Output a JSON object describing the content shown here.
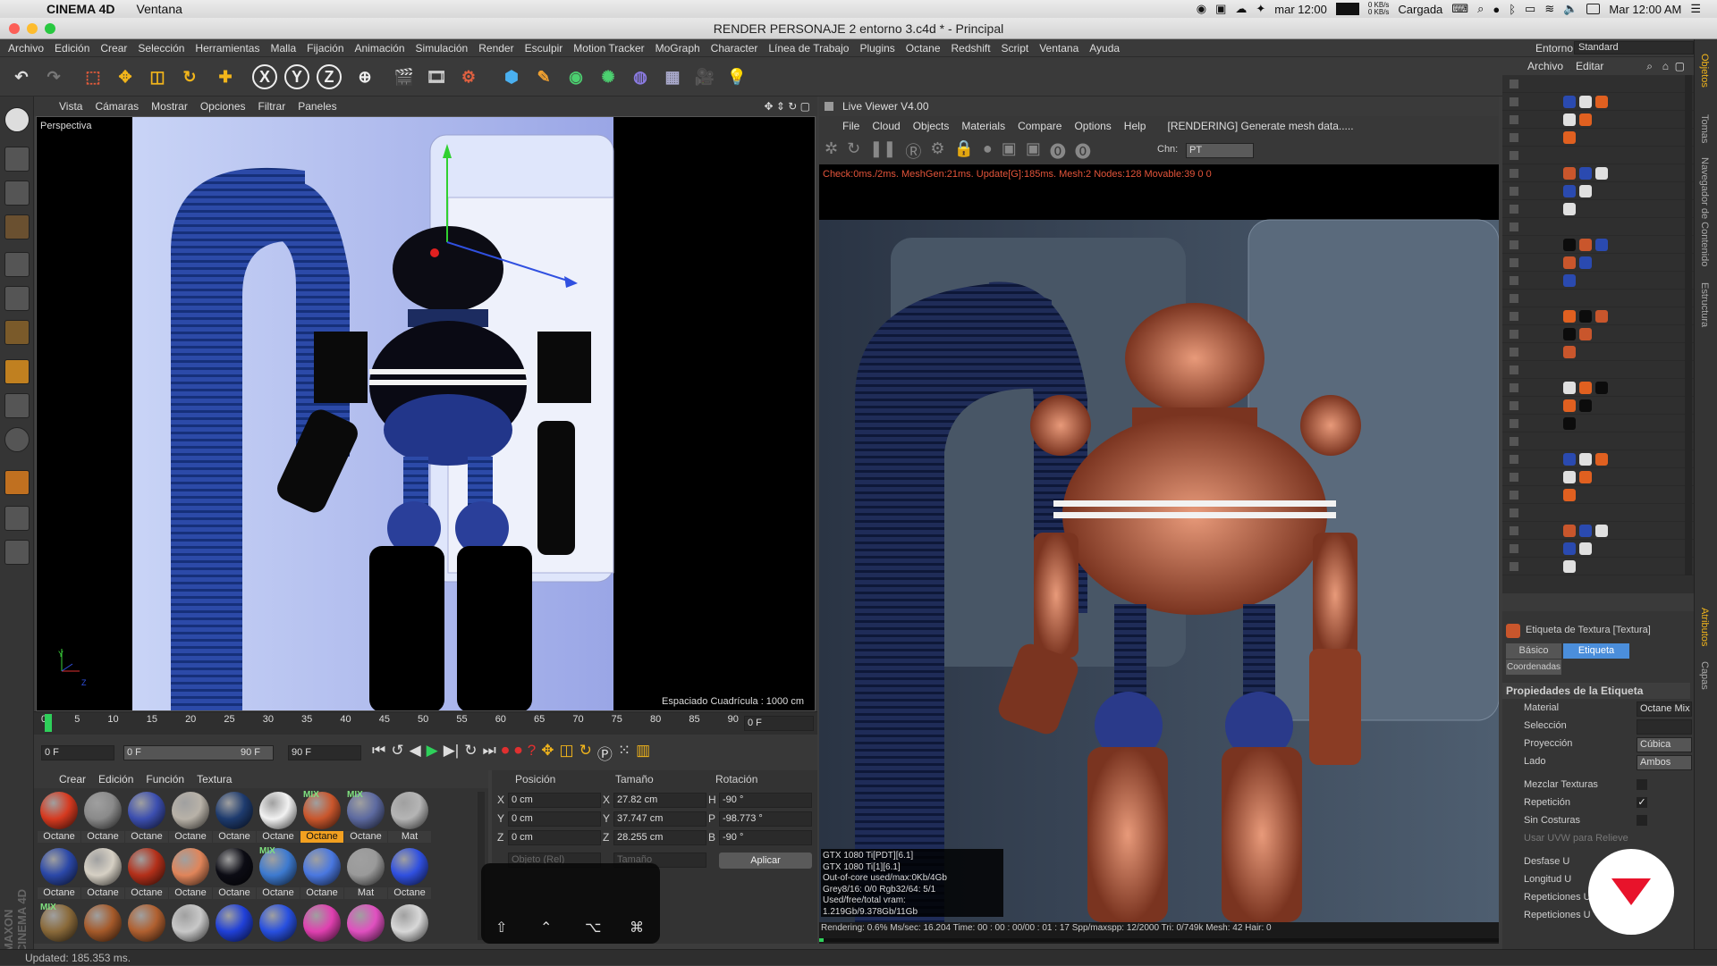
{
  "mac": {
    "app": "CINEMA 4D",
    "menu": "Ventana",
    "time_short": "mar 12:00",
    "net_up": "0 KB/s",
    "net_down": "0 KB/s",
    "battery": "Cargada",
    "datetime": "Mar 12:00 AM"
  },
  "window": {
    "title": "RENDER PERSONAJE 2 entorno 3.c4d * - Principal"
  },
  "menubar": {
    "items": [
      "Archivo",
      "Edición",
      "Crear",
      "Selección",
      "Herramientas",
      "Malla",
      "Fijación",
      "Animación",
      "Simulación",
      "Render",
      "Esculpir",
      "Motion Tracker",
      "MoGraph",
      "Character",
      "Línea de Trabajo",
      "Plugins",
      "Octane",
      "Redshift",
      "Script",
      "Ventana",
      "Ayuda"
    ],
    "entorno_label": "Entorno:",
    "entorno_value": "Standard"
  },
  "viewport": {
    "menu": [
      "Vista",
      "Cámaras",
      "Mostrar",
      "Opciones",
      "Filtrar",
      "Paneles"
    ],
    "name": "Perspectiva",
    "grid": "Espaciado Cuadrícula : 1000 cm",
    "axis_y": "Y",
    "axis_z": "Z"
  },
  "timeline": {
    "ticks": [
      "0",
      "5",
      "10",
      "15",
      "20",
      "25",
      "30",
      "35",
      "40",
      "45",
      "50",
      "55",
      "60",
      "65",
      "70",
      "75",
      "80",
      "85",
      "90"
    ],
    "frame": "0 F"
  },
  "transport": {
    "start": "0 F",
    "range_start": "0 F",
    "range_end": "90 F",
    "end": "90 F"
  },
  "materials": {
    "menu": [
      "Crear",
      "Edición",
      "Función",
      "Textura"
    ],
    "items": [
      {
        "label": "Octane",
        "color": "#d63a20",
        "mix": ""
      },
      {
        "label": "Octane",
        "color": "#8a8a8a",
        "mix": ""
      },
      {
        "label": "Octane",
        "color": "#3c4fb0",
        "mix": ""
      },
      {
        "label": "Octane",
        "color": "#b8b2a8",
        "mix": ""
      },
      {
        "label": "Octane",
        "color": "#1e3b6e",
        "mix": ""
      },
      {
        "label": "Octane",
        "color": "#f2f2f2",
        "mix": ""
      },
      {
        "label": "Octane",
        "color": "#c9562c",
        "mix": "MIX",
        "selected": true
      },
      {
        "label": "Octane",
        "color": "#5d6aa0",
        "mix": "MIX"
      },
      {
        "label": "Mat",
        "color": "#b5b5b5",
        "mix": ""
      },
      {
        "label": "Octane",
        "color": "#2b48a8",
        "mix": ""
      },
      {
        "label": "Octane",
        "color": "#d6d0c4",
        "mix": ""
      },
      {
        "label": "Octane",
        "color": "#b3301a",
        "mix": ""
      },
      {
        "label": "Octane",
        "color": "#e0855a",
        "mix": ""
      },
      {
        "label": "Octane",
        "color": "#0c0c14",
        "mix": ""
      },
      {
        "label": "Octane",
        "color": "#3d7ad0",
        "mix": "MIX"
      },
      {
        "label": "Octane",
        "color": "#4a78e0",
        "mix": ""
      },
      {
        "label": "Mat",
        "color": "#9a9a9a",
        "mix": ""
      },
      {
        "label": "Octane",
        "color": "#3050e0",
        "mix": ""
      },
      {
        "label": "",
        "color": "#8a6a3a",
        "mix": "MIX"
      },
      {
        "label": "",
        "color": "#a55a2a",
        "mix": ""
      },
      {
        "label": "",
        "color": "#b06030",
        "mix": ""
      },
      {
        "label": "",
        "color": "#c8c8c8",
        "mix": ""
      },
      {
        "label": "",
        "color": "#2040d8",
        "mix": ""
      },
      {
        "label": "",
        "color": "#2850e0",
        "mix": ""
      },
      {
        "label": "",
        "color": "#e040b0",
        "mix": ""
      },
      {
        "label": "",
        "color": "#e050c0",
        "mix": ""
      },
      {
        "label": "",
        "color": "#d8d8d8",
        "mix": ""
      }
    ]
  },
  "coords": {
    "headers": [
      "Posición",
      "Tamaño",
      "Rotación"
    ],
    "rows": [
      {
        "a": "X",
        "pos": "0 cm",
        "b": "X",
        "size": "27.82 cm",
        "c": "H",
        "rot": "-90 °"
      },
      {
        "a": "Y",
        "pos": "0 cm",
        "b": "Y",
        "size": "37.747 cm",
        "c": "P",
        "rot": "-98.773 °"
      },
      {
        "a": "Z",
        "pos": "0 cm",
        "b": "Z",
        "size": "28.255 cm",
        "c": "B",
        "rot": "-90 °"
      }
    ],
    "mode": "Objeto (Rel)",
    "size_mode": "Tamaño",
    "apply": "Aplicar"
  },
  "live_viewer": {
    "title": "Live Viewer V4.00",
    "menu": [
      "File",
      "Cloud",
      "Objects",
      "Materials",
      "Compare",
      "Options",
      "Help"
    ],
    "status_msg": "[RENDERING] Generate mesh data.....",
    "chn_label": "Chn:",
    "chn_value": "PT",
    "info": "Check:0ms./2ms. MeshGen:21ms. Update[G]:185ms. Mesh:2 Nodes:128 Movable:39  0 0",
    "stats": [
      "GTX 1080 Ti[PDT][6.1]",
      "GTX 1080 Ti[1][6.1]",
      "Out-of-core used/max:0Kb/4Gb",
      "Grey8/16: 0/0        Rgb32/64: 5/1",
      "Used/free/total vram: 1.219Gb/9.378Gb/11Gb"
    ],
    "render_bar": "Rendering: 0.6%  Ms/sec: 16.204  Time: 00 : 00 : 00/00 : 01 : 17  Spp/maxspp: 12/2000  Tri: 0/749k  Mesh: 42  Hair: 0",
    "progress": 0.006
  },
  "right": {
    "top_menu": [
      "Archivo",
      "Editar"
    ],
    "attr_title": "Etiqueta de Textura [Textura]",
    "tabs": [
      "Básico",
      "Etiqueta",
      "Coordenadas"
    ],
    "section": "Propiedades de la Etiqueta",
    "props": [
      {
        "label": "Material",
        "value": "Octane Mix"
      },
      {
        "label": "Selección",
        "value": ""
      },
      {
        "label": "Proyección",
        "value": "Cúbica"
      },
      {
        "label": "Lado",
        "value": "Ambos"
      }
    ],
    "checks": [
      {
        "label": "Mezclar Texturas",
        "checked": false
      },
      {
        "label": "Repetición",
        "checked": true
      },
      {
        "label": "Sin Costuras",
        "checked": false
      },
      {
        "label": "Usar UVW para Relieve",
        "checked": true
      }
    ],
    "offsets": [
      "Desfase U",
      "Longitud U",
      "Repeticiones U",
      "Repeticiones U"
    ],
    "side_tabs": [
      "Objetos",
      "Tomas",
      "Navegador de Contenido",
      "Estructura"
    ],
    "side_tabs_lower": [
      "Atributos",
      "Capas"
    ]
  },
  "status": {
    "text": "Updated: 185.353 ms."
  },
  "maxon": "MAXON CINEMA 4D"
}
